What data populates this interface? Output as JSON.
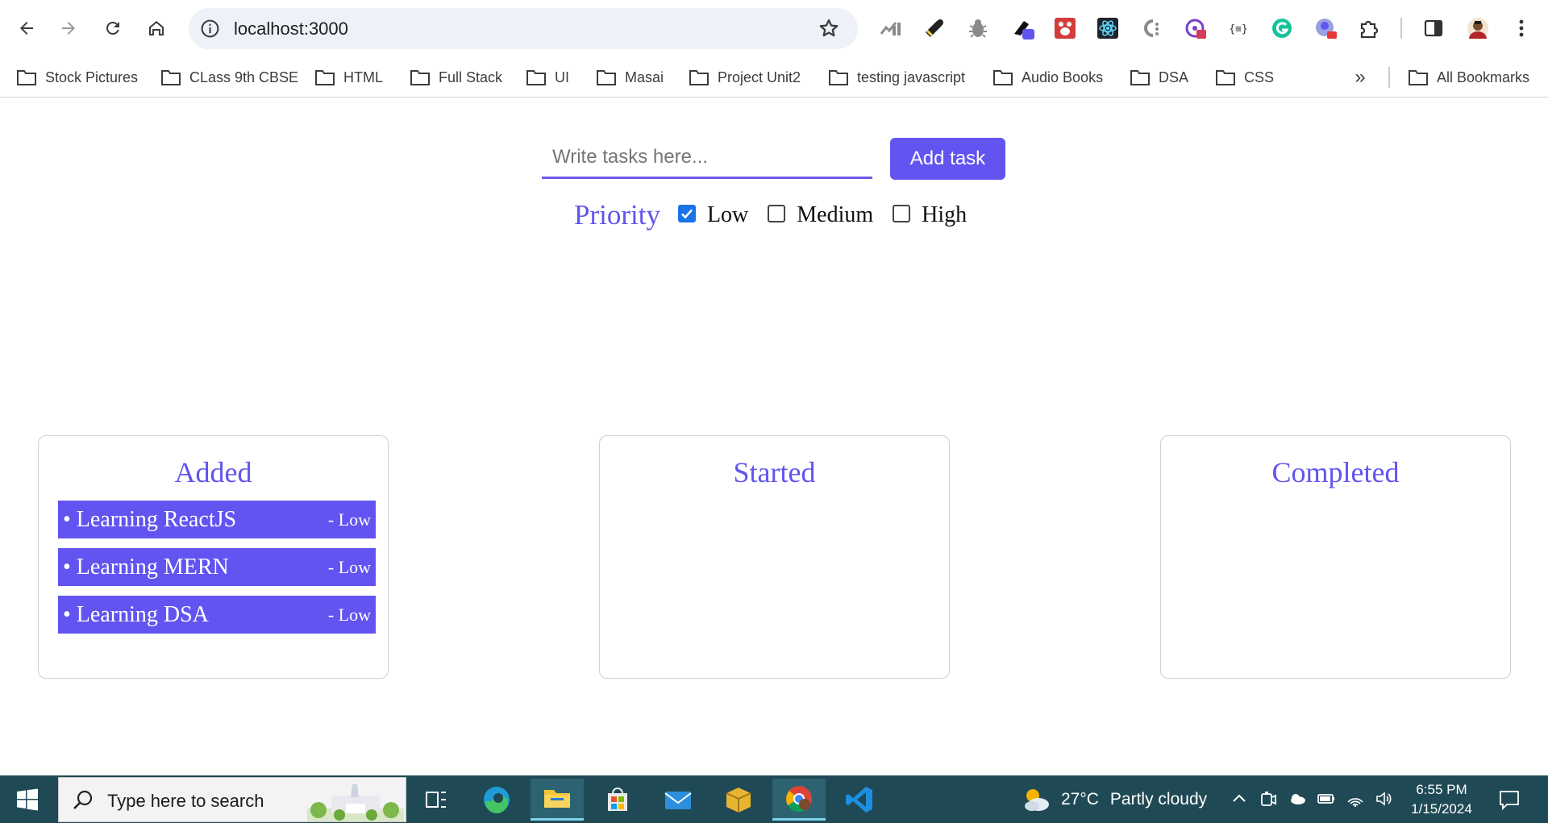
{
  "browser": {
    "url": "localhost:3000",
    "extensions": [
      "chart-extension-icon",
      "colorzilla-icon",
      "bug-extension-icon",
      "pen-badge-icon",
      "red-paw-icon",
      "react-devtools-icon",
      "c-dots-icon",
      "redux-icon",
      "json-braces-icon",
      "grammarly-icon",
      "globe-badge-icon",
      "puzzle-icon"
    ],
    "bookmarks": [
      {
        "label": "Stock Pictures"
      },
      {
        "label": "CLass 9th CBSE"
      },
      {
        "label": "HTML"
      },
      {
        "label": "Full Stack"
      },
      {
        "label": "UI"
      },
      {
        "label": "Masai"
      },
      {
        "label": "Project Unit2"
      },
      {
        "label": "testing javascript"
      },
      {
        "label": "Audio Books"
      },
      {
        "label": "DSA"
      },
      {
        "label": "CSS"
      }
    ],
    "more_bookmarks": "»",
    "all_bookmarks": "All Bookmarks"
  },
  "app": {
    "input_placeholder": "Write tasks here...",
    "input_value": "",
    "add_button": "Add task",
    "priority_label": "Priority",
    "priorities": [
      {
        "label": "Low",
        "checked": true
      },
      {
        "label": "Medium",
        "checked": false
      },
      {
        "label": "High",
        "checked": false
      }
    ],
    "columns": [
      {
        "title": "Added",
        "tasks": [
          {
            "title": "• Learning ReactJS",
            "priority": "- Low"
          },
          {
            "title": "• Learning MERN",
            "priority": "- Low"
          },
          {
            "title": "• Learning DSA",
            "priority": "- Low"
          }
        ]
      },
      {
        "title": "Started",
        "tasks": []
      },
      {
        "title": "Completed",
        "tasks": []
      }
    ],
    "accent_color": "#6254f0"
  },
  "taskbar": {
    "search_placeholder": "Type here to search",
    "apps": [
      "task-view-icon",
      "edge-icon",
      "file-explorer-icon",
      "microsoft-store-icon",
      "mail-icon",
      "package-icon",
      "chrome-icon",
      "vscode-icon"
    ],
    "weather": {
      "temp": "27°C",
      "condition": "Partly cloudy"
    },
    "time": "6:55 PM",
    "date": "1/15/2024"
  }
}
